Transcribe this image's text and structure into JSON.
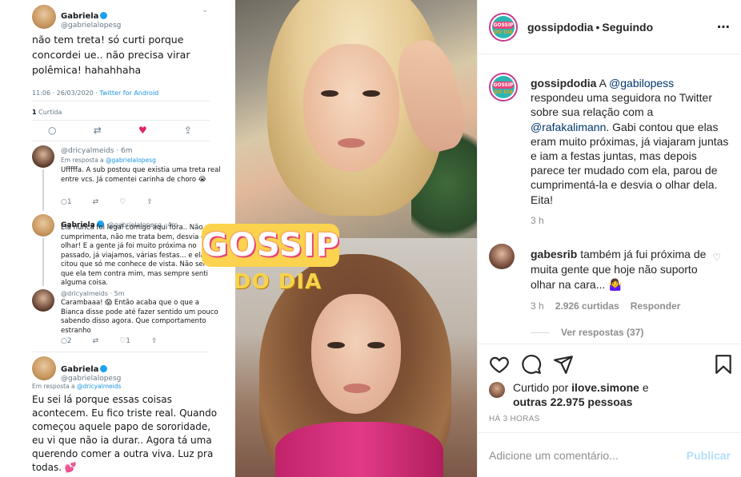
{
  "tweet": {
    "author_name": "Gabriela",
    "author_handle": "@gabrielalopesg",
    "text": "não tem treta! só curti porque concordei ue.. não precisa virar polêmica! hahahhaha",
    "timestamp": "11:06 · 26/03/2020 · ",
    "source": "Twitter for Android",
    "likes_count": "1",
    "likes_label": "Curtida",
    "replies": [
      {
        "handle": "@dricyalmeids · 6m",
        "in_reply_prefix": "Em resposta a ",
        "in_reply_to": "@gabrielalopesg",
        "text": "Ufffffa. A sub postou que existia uma treta real entre vcs. Já comentei carinha de choro 😭",
        "reply_count": "1",
        "like_count": ""
      },
      {
        "name": "Gabriela",
        "handle": "@gabrielalopesg · 4m",
        "text": "Ela nunca foi legal comigo aqui fora.. Não me cumprimenta, não me trata bem, desvia o olhar! E a gente já foi muito próxima no passado, já viajamos, várias festas... e ela citou que só me conhece de vista. Não sei o que ela tem contra mim, mas sempre senti alguma coisa."
      },
      {
        "handle": "@dricyalmeids · 5m",
        "text": "Carambaaa! 😱 Então acaba que o que a Bianca disse pode até fazer sentido um pouco sabendo disso agora. Que comportamento estranho",
        "reply_count": "2",
        "like_count": "1"
      }
    ],
    "bottom": {
      "name": "Gabriela",
      "handle": "@gabrielalopesg",
      "in_reply_prefix": "Em resposta a ",
      "in_reply_to": "@dricyalmeids",
      "text": "Eu sei lá porque essas coisas acontecem. Eu fico triste real. Quando começou aquele papo de sororidade, eu vi que não ia durar.. Agora tá uma querendo comer a outra viva. Luz pra todas. 💕"
    }
  },
  "overlay_logo": {
    "line1": "GOSSIP",
    "line2": "DO DIA"
  },
  "avatar_logo": {
    "line1": "GOSSIP",
    "line2": "DO DIA"
  },
  "header": {
    "username": "gossipdodia",
    "separator": "•",
    "follow_label": "Seguindo",
    "more_icon": "⋯"
  },
  "caption": {
    "username": "gossipdodia",
    "text_1": " A ",
    "mention_1": "@gabilopess",
    "text_2": " respondeu uma seguidora no Twitter sobre sua relação com a ",
    "mention_2": "@rafakalimann",
    "text_3": ". Gabi contou que elas eram muito próximas, já viajaram juntas e iam a festas juntas, mas depois parece ter mudado com ela, parou de cumprimentá-la e desvia o olhar dela. Eita!",
    "time": "3 h"
  },
  "comment": {
    "username": "gabesrib",
    "text": " também já fui próxima de muita gente que hoje não suporto olhar na cara... 🤷‍♀️",
    "time": "3 h",
    "likes": "2.926 curtidas",
    "reply_label": "Responder",
    "view_replies": "Ver respostas (37)"
  },
  "likes": {
    "prefix": "Curtido por ",
    "user": "ilove.simone",
    "middle": " e",
    "others": "outras 22.975 pessoas"
  },
  "posted": "HÁ 3 HORAS",
  "add_comment": {
    "placeholder": "Adicione um comentário...",
    "publish_label": "Publicar"
  },
  "colors": {
    "link": "#00376b",
    "muted": "#8e8e8e",
    "publish_disabled": "#b2dffc",
    "twitter_blue": "#1da1f2",
    "brand_pink": "#e8457a",
    "brand_yellow": "#fbd34e"
  }
}
